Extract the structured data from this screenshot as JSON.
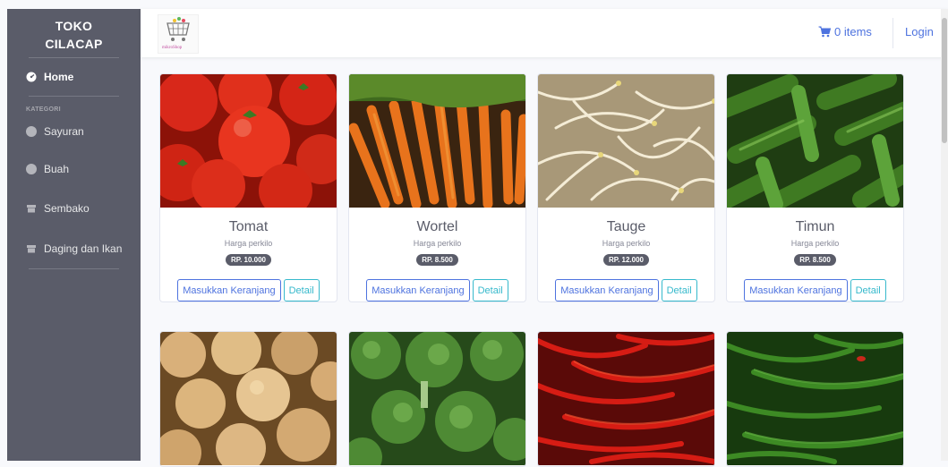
{
  "sidebar": {
    "brand_line1": "TOKO",
    "brand_line2": "CILACAP",
    "home_label": "Home",
    "heading": "KATEGORI",
    "items": [
      {
        "label": "Sayuran",
        "icon": "circle-icon"
      },
      {
        "label": "Buah",
        "icon": "circle-icon"
      },
      {
        "label": "Sembako",
        "icon": "archive-icon"
      },
      {
        "label": "Daging dan Ikan",
        "icon": "archive-icon"
      }
    ]
  },
  "topbar": {
    "logo_text": "mikroShop",
    "cart_label": "0 items",
    "login_label": "Login"
  },
  "colors": {
    "sidebar_bg": "#5a5c69",
    "primary": "#4e73df",
    "info": "#36b9cc"
  },
  "products": [
    {
      "name": "Tomat",
      "subtitle": "Harga perkilo",
      "price": "RP. 10.000",
      "add_label": "Masukkan Keranjang",
      "detail_label": "Detail"
    },
    {
      "name": "Wortel",
      "subtitle": "Harga perkilo",
      "price": "RP. 8.500",
      "add_label": "Masukkan Keranjang",
      "detail_label": "Detail"
    },
    {
      "name": "Tauge",
      "subtitle": "Harga perkilo",
      "price": "RP. 12.000",
      "add_label": "Masukkan Keranjang",
      "detail_label": "Detail"
    },
    {
      "name": "Timun",
      "subtitle": "Harga perkilo",
      "price": "RP. 8.500",
      "add_label": "Masukkan Keranjang",
      "detail_label": "Detail"
    }
  ]
}
